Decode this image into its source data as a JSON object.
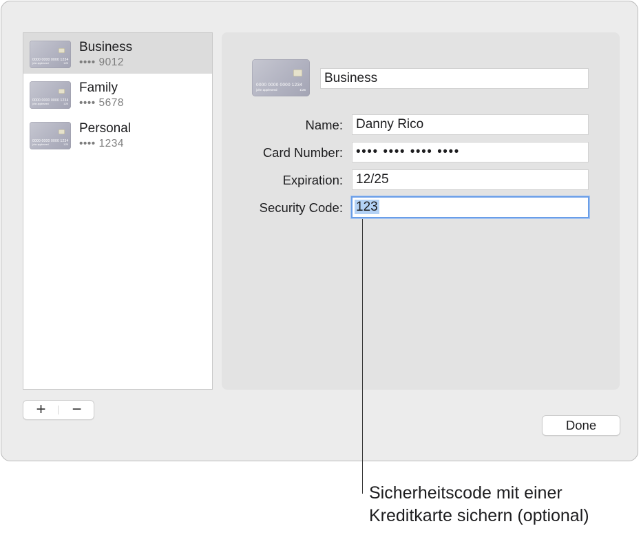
{
  "cards": [
    {
      "name": "Business",
      "masked_number": "•••• 9012",
      "thumb_number": "0000 0000 0000 1234",
      "thumb_holder": "john appleseed",
      "thumb_expiry": "1/25",
      "selected": true
    },
    {
      "name": "Family",
      "masked_number": "•••• 5678",
      "thumb_number": "0000 0000 0000 1234",
      "thumb_holder": "john appleseed",
      "thumb_expiry": "1/25",
      "selected": false
    },
    {
      "name": "Personal",
      "masked_number": "•••• 1234",
      "thumb_number": "0000 0000 0000 1234",
      "thumb_holder": "john appleseed",
      "thumb_expiry": "1/25",
      "selected": false
    }
  ],
  "list_controls": {
    "add_label": "+",
    "remove_label": "−"
  },
  "detail": {
    "card_title": "Business",
    "thumb_number": "0000 0000 0000 1234",
    "thumb_holder": "john appleseed",
    "thumb_expiry": "1/25",
    "fields": {
      "name": {
        "label": "Name:",
        "value": "Danny Rico"
      },
      "card_number": {
        "label": "Card Number:",
        "value": "•••• •••• •••• ••••"
      },
      "expiration": {
        "label": "Expiration:",
        "value": "12/25"
      },
      "security_code": {
        "label": "Security Code:",
        "value": "123"
      }
    }
  },
  "done_label": "Done",
  "callout": "Sicherheitscode mit einer Kreditkarte sichern (optional)",
  "colors": {
    "focus_ring": "#6a9ee8",
    "selection": "#b3d1f5",
    "selected_row": "#dcdcdc"
  }
}
